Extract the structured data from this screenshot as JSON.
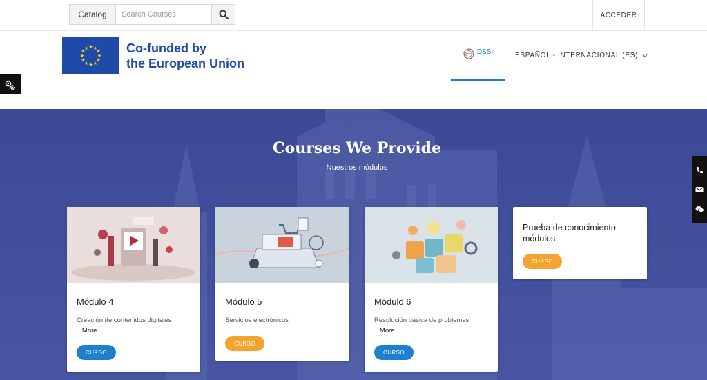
{
  "topbar": {
    "catalog_label": "Catalog",
    "search_placeholder": "Search Courses",
    "login_label": "ACCEDER"
  },
  "header": {
    "eu_line1": "Co-funded by",
    "eu_line2": "the European Union",
    "dssi_label": "DSSI",
    "language_label": "ESPAÑOL - INTERNACIONAL (ES)"
  },
  "hero": {
    "title": "Courses We Provide",
    "subtitle": "Nuestros módulos"
  },
  "courses": [
    {
      "title": "Módulo 4",
      "description": "Creación de contenidos digitales",
      "more": "...More",
      "button": "CURSO",
      "button_color": "#1e7fd0"
    },
    {
      "title": "Módulo 5",
      "description": "Servicios electrónicos",
      "button": "CURSO",
      "button_color": "#f4a42e"
    },
    {
      "title": "Módulo 6",
      "description": "Resolución básica de problemas",
      "more": "...More",
      "button": "CURSO",
      "button_color": "#1e7fd0"
    },
    {
      "title": "Prueba de conocimiento - módulos",
      "button": "CURSO",
      "button_color": "#f4a42e"
    }
  ],
  "colors": {
    "accent_blue": "#1e7fd0",
    "accent_orange": "#f4a42e",
    "hero_bg": "#3f4d99",
    "eu_blue": "#1f4aa8"
  },
  "icons": [
    "search-icon",
    "gears-icon",
    "phone-icon",
    "email-icon",
    "chat-icon",
    "chevron-down-icon"
  ]
}
